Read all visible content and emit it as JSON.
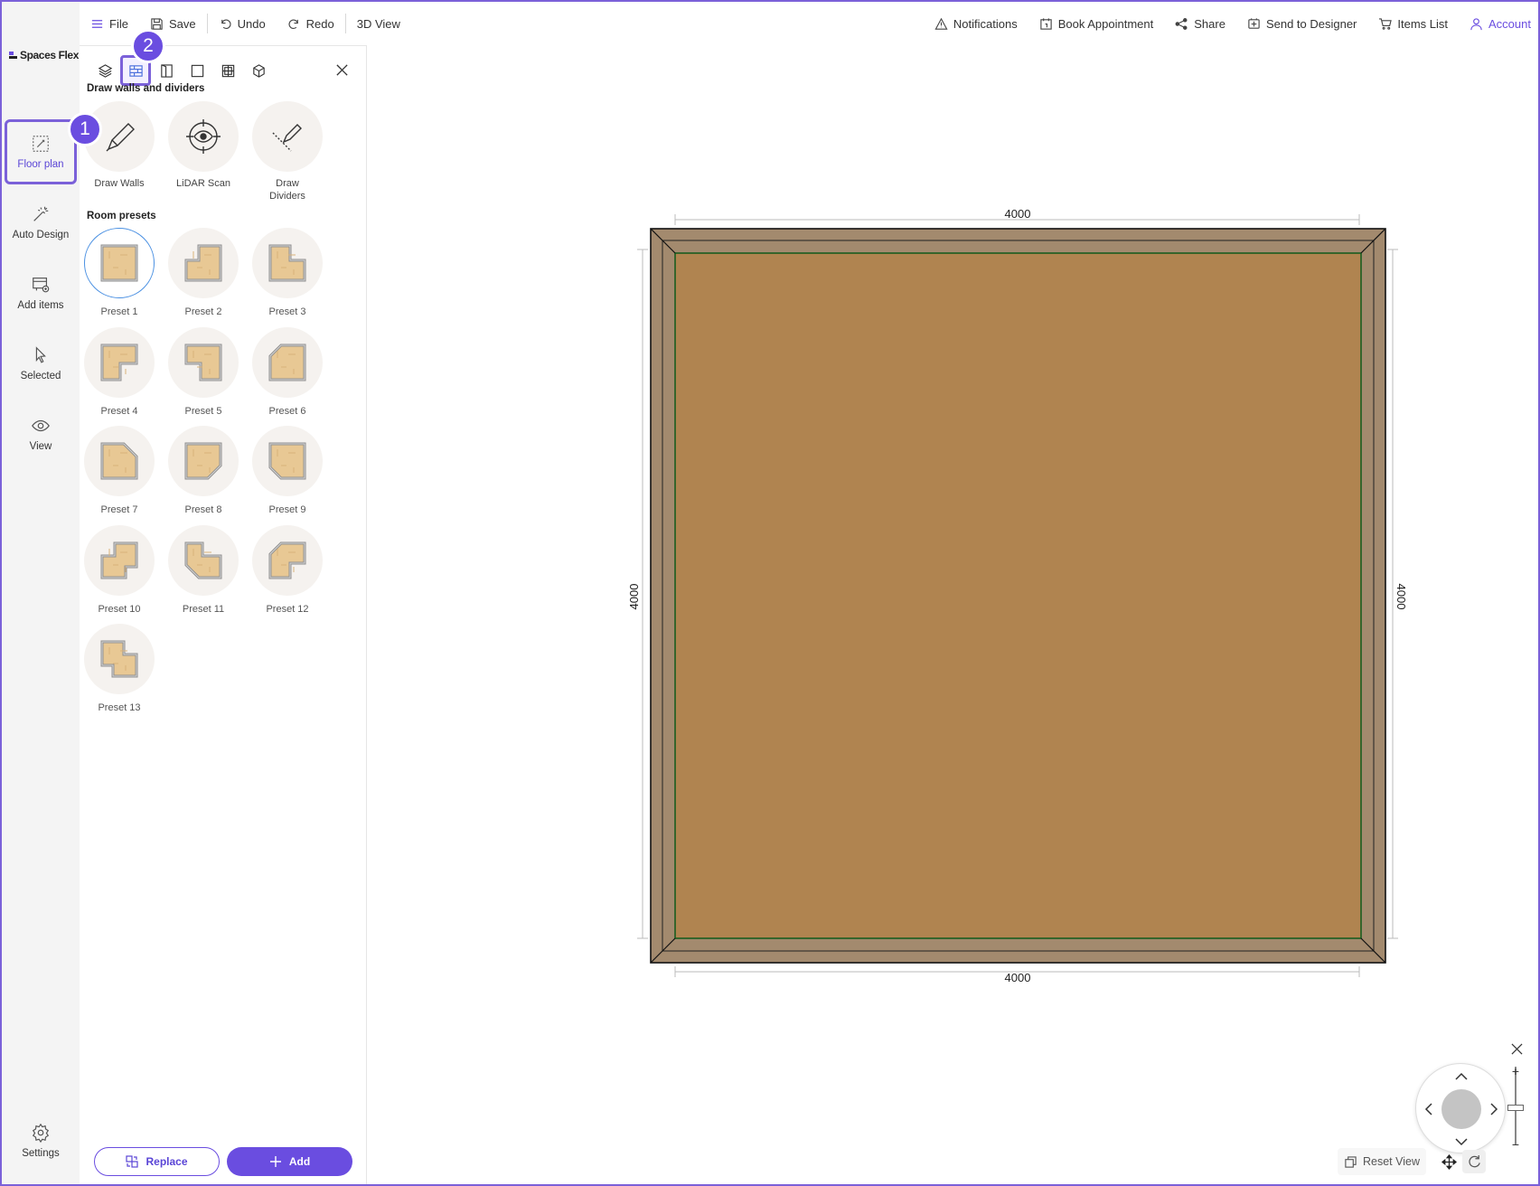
{
  "app": {
    "logo_text": "Spaces Flex"
  },
  "topbar": {
    "file": "File",
    "save": "Save",
    "undo": "Undo",
    "redo": "Redo",
    "view3d": "3D View",
    "notifications": "Notifications",
    "book": "Book Appointment",
    "share": "Share",
    "send": "Send to Designer",
    "items_list": "Items List",
    "account": "Account"
  },
  "rail": {
    "items": [
      {
        "label": "Floor plan",
        "icon": "floorplan-icon",
        "active": true
      },
      {
        "label": "Auto Design",
        "icon": "magic-wand-icon"
      },
      {
        "label": "Add items",
        "icon": "add-items-icon"
      },
      {
        "label": "Selected",
        "icon": "cursor-icon"
      },
      {
        "label": "View",
        "icon": "eye-icon"
      }
    ],
    "settings": "Settings"
  },
  "badges": {
    "one": "1",
    "two": "2"
  },
  "panel": {
    "draw_title": "Draw walls and dividers",
    "tools": [
      {
        "label": "Draw Walls",
        "icon": "pencil-icon"
      },
      {
        "label": "LiDAR Scan",
        "icon": "scan-eye-icon"
      },
      {
        "label": "Draw Dividers",
        "icon": "divider-pencil-icon"
      }
    ],
    "presets_title": "Room presets",
    "presets": [
      "Preset 1",
      "Preset 2",
      "Preset 3",
      "Preset 4",
      "Preset 5",
      "Preset 6",
      "Preset 7",
      "Preset 8",
      "Preset 9",
      "Preset 10",
      "Preset 11",
      "Preset 12",
      "Preset 13"
    ],
    "selected_preset": "Preset 1",
    "replace": "Replace",
    "add": "Add"
  },
  "plan": {
    "top_dim": "4000",
    "bottom_dim": "4000",
    "left_dim": "4000",
    "right_dim": "4000",
    "floor_color": "#b08450",
    "wall_color": "#a38a6e",
    "accent_color": "#6a4de0"
  },
  "controls": {
    "reset_view": "Reset View"
  }
}
